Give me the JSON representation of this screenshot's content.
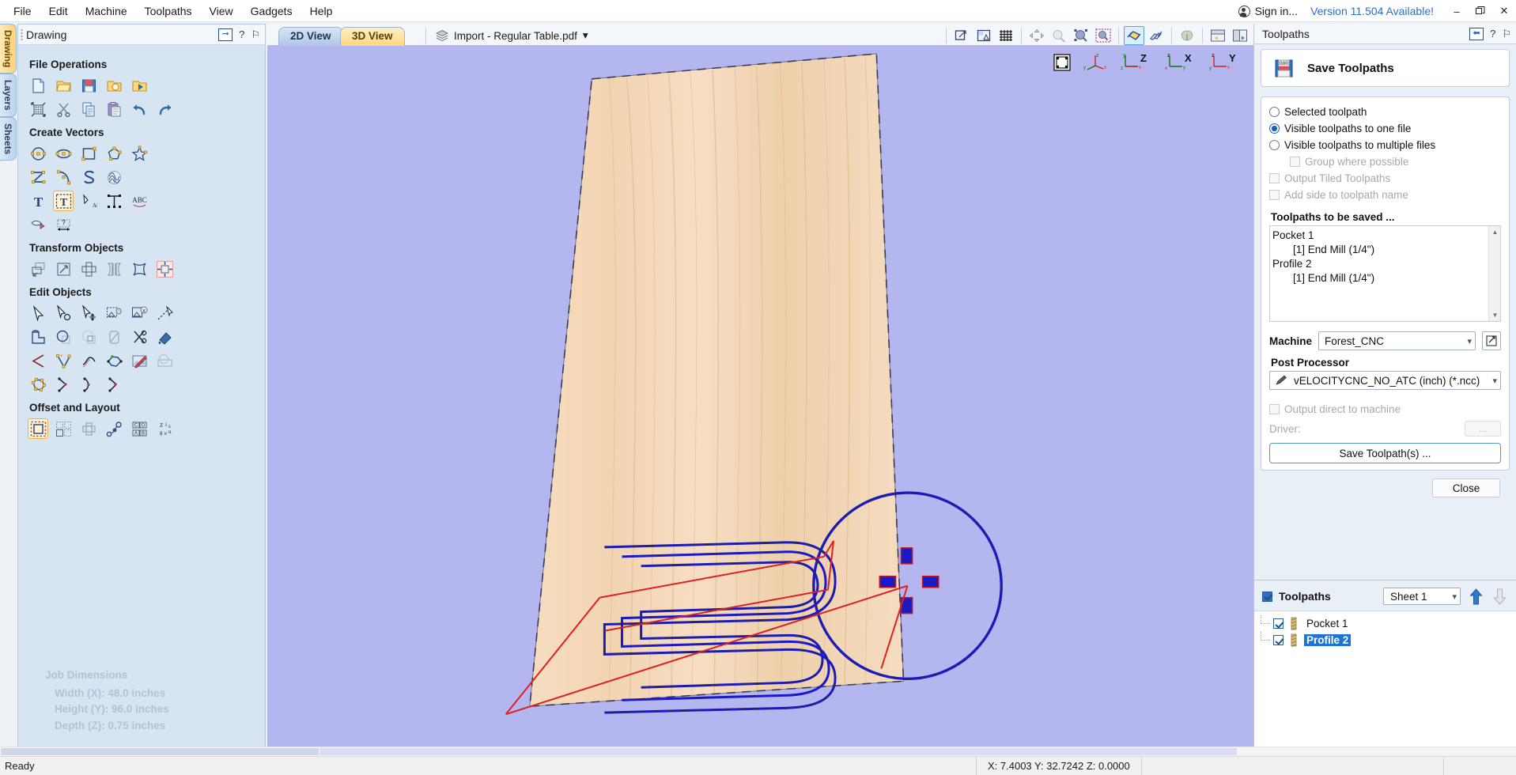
{
  "window": {
    "menus": [
      "File",
      "Edit",
      "Machine",
      "Toolpaths",
      "View",
      "Gadgets",
      "Help"
    ],
    "signin_label": "Sign in...",
    "version_notice": "Version 11.504 Available!",
    "minimize": "–",
    "restore": "❐",
    "close": "✕"
  },
  "left_dock": {
    "vertical_tabs": [
      {
        "label": "Drawing",
        "active": true
      },
      {
        "label": "Layers",
        "active": false
      },
      {
        "label": "Sheets",
        "active": false
      }
    ],
    "panel_title": "Drawing",
    "help_glyph": "?",
    "pin_glyph": "⚐",
    "groups": [
      {
        "title": "File Operations",
        "rows": [
          [
            "new-file-icon",
            "open-file-icon",
            "save-file-icon",
            "open-recent-icon",
            "import-vectors-icon"
          ],
          [
            "job-setup-icon",
            "cut-icon",
            "copy-icon",
            "paste-icon",
            "undo-icon",
            "redo-icon"
          ]
        ]
      },
      {
        "title": "Create Vectors",
        "rows": [
          [
            "draw-circle-icon",
            "draw-ellipse-icon",
            "draw-rectangle-icon",
            "draw-polygon-icon",
            "draw-star-icon"
          ],
          [
            "draw-polyline-icon",
            "draw-curve-icon",
            "draw-curve-s-icon",
            "draw-texture-icon"
          ],
          [
            "draw-text-icon",
            "text-selected-icon",
            "text-on-curve-icon",
            "auto-text-layout-icon",
            "text-arc-icon"
          ],
          [
            "trace-bitmap-icon",
            "dimension-icon"
          ]
        ]
      },
      {
        "title": "Transform Objects",
        "rows": [
          [
            "move-object-icon",
            "scale-object-icon",
            "rotate-object-icon",
            "mirror-object-icon",
            "distort-object-icon",
            "align-objects-icon"
          ]
        ]
      },
      {
        "title": "Edit Objects",
        "rows": [
          [
            "node-edit-icon",
            "select-tool-icon",
            "move-nodes-icon",
            "group-objects-icon",
            "ungroup-objects-icon",
            "join-vectors-icon"
          ],
          [
            "weld-vectors-icon",
            "subtract-vectors-icon",
            "trim-vectors-icon",
            "fillet-icon",
            "cut-vectors-icon",
            "fill-vectors-icon"
          ],
          [
            "create-sharp-corner-icon",
            "insert-node-icon",
            "smooth-node-icon",
            "close-vector-icon",
            "edit-bitmap-icon",
            "fade-bitmap-icon"
          ],
          [
            "measure-shape-icon",
            "open-vector-icon",
            "join-curve-icon",
            "trim-curve-icon"
          ]
        ]
      },
      {
        "title": "Offset and Layout",
        "rows": [
          [
            "offset-vectors-icon",
            "array-copy-icon",
            "nest-parts-icon",
            "object-order-icon",
            "block-copy-icon",
            "texture-text-icon"
          ]
        ]
      }
    ],
    "job_dimensions": {
      "title": "Job Dimensions",
      "width": "Width  (X): 48.0 inches",
      "height": "Height (Y): 96.0 inches",
      "depth": "Depth  (Z): 0.75 inches"
    }
  },
  "center": {
    "tabs": [
      {
        "label": "2D View",
        "active": false
      },
      {
        "label": "3D View",
        "active": true
      }
    ],
    "file_chip": "Import - Regular Table.pdf",
    "file_chip_caret": "▾",
    "toolbar_icons": [
      "zoom-box-icon",
      "zoom-extents-icon",
      "toggle-grid-icon",
      "pan-icon",
      "zoom-selected-icon",
      "zoom-object-icon",
      "zoom-drawing-icon",
      "toggle-solid-icon",
      "toggle-toolpath-icon",
      "toggle-material-icon",
      "two-view-layout-icon",
      "split-view-layout-icon"
    ],
    "gizmos": [
      "iso-view-icon",
      "xyz-axis-icon",
      "z-axis-icon",
      "x-axis-icon",
      "y-axis-icon"
    ],
    "axis_labels": [
      "Z",
      "X",
      "Y"
    ]
  },
  "right_dock": {
    "panel_title": "Toolpaths",
    "help_glyph": "?",
    "pin_glyph": "⚐",
    "save_toolpaths_button": "Save Toolpaths",
    "options": [
      {
        "type": "radio",
        "label": "Selected toolpath",
        "checked": false,
        "disabled": false,
        "indent": false
      },
      {
        "type": "radio",
        "label": "Visible toolpaths to one file",
        "checked": true,
        "disabled": false,
        "indent": false
      },
      {
        "type": "radio",
        "label": "Visible toolpaths to multiple files",
        "checked": false,
        "disabled": false,
        "indent": false
      },
      {
        "type": "check",
        "label": "Group where possible",
        "checked": false,
        "disabled": true,
        "indent": true
      },
      {
        "type": "check",
        "label": "Output Tiled Toolpaths",
        "checked": false,
        "disabled": true,
        "indent": false
      },
      {
        "type": "check",
        "label": "Add side to toolpath name",
        "checked": false,
        "disabled": true,
        "indent": false
      }
    ],
    "to_be_saved_label": "Toolpaths to be saved ...",
    "to_be_saved_items": [
      {
        "text": "Pocket 1",
        "indent": false
      },
      {
        "text": "[1] End Mill (1/4\")",
        "indent": true
      },
      {
        "text": "Profile 2",
        "indent": false
      },
      {
        "text": "[1] End Mill (1/4\")",
        "indent": true
      }
    ],
    "machine_label": "Machine",
    "machine_value": "Forest_CNC",
    "machine_edit_icon": "edit-machine-icon",
    "post_processor_label": "Post Processor",
    "post_processor_value": "vELOCITYCNC_NO_ATC (inch) (*.ncc)",
    "output_direct_label": "Output direct to machine",
    "driver_label": "Driver:",
    "driver_dots": "...",
    "save_toolpaths_action": "Save Toolpath(s) ...",
    "close_button": "Close",
    "toolpath_list": {
      "title": "Toolpaths",
      "sheet_value": "Sheet 1",
      "items": [
        {
          "name": "Pocket 1",
          "checked": true,
          "selected": false
        },
        {
          "name": "Profile 2",
          "checked": true,
          "selected": true
        }
      ]
    }
  },
  "status": {
    "ready": "Ready",
    "coords": "X:  7.4003 Y: 32.7242 Z:  0.0000"
  },
  "colors": {
    "accent_blue": "#1e74d6",
    "view_background": "#b4b7ef",
    "wood": "#f3d7b5",
    "toolpath_blue": "#1a1ac8",
    "rapid_red": "#e02020",
    "version_link": "#2e6fc7"
  }
}
